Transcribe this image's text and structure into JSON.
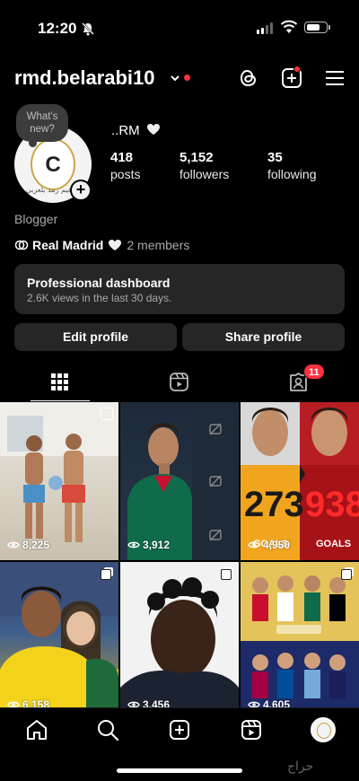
{
  "status_bar": {
    "time": "12:20"
  },
  "header": {
    "username": "rmd.belarabi10",
    "icons": [
      "threads-icon",
      "create-icon",
      "menu-icon"
    ]
  },
  "profile": {
    "note_placeholder": "What's new?",
    "display_name": "..RM",
    "stats": [
      {
        "value": "418",
        "label": "posts"
      },
      {
        "value": "5,152",
        "label": "followers"
      },
      {
        "value": "35",
        "label": "following"
      }
    ],
    "category": "Blogger",
    "channel": {
      "name": "Real Madrid",
      "members": "2 members"
    },
    "avatar_text": "الزعيم رمد بلعربي"
  },
  "dashboard": {
    "title": "Professional dashboard",
    "subtitle": "2.6K views in the last 30 days."
  },
  "buttons": {
    "edit": "Edit profile",
    "share": "Share profile"
  },
  "tabs": {
    "tagged_badge": "11"
  },
  "grid": {
    "posts": [
      {
        "views": "8,225",
        "type": "reel"
      },
      {
        "views": "3,912",
        "type": "reel"
      },
      {
        "views": "4,950",
        "type": "carousel",
        "goals_left": "273",
        "goals_right": "938",
        "goals_word": "GOALS"
      },
      {
        "views": "6,158",
        "type": "carousel"
      },
      {
        "views": "3,456",
        "type": "carousel"
      },
      {
        "views": "4,605",
        "type": "carousel"
      }
    ]
  },
  "colors": {
    "accent_red": "#ff3040",
    "surface": "#262626",
    "background": "#000000"
  },
  "watermark": "حراج"
}
